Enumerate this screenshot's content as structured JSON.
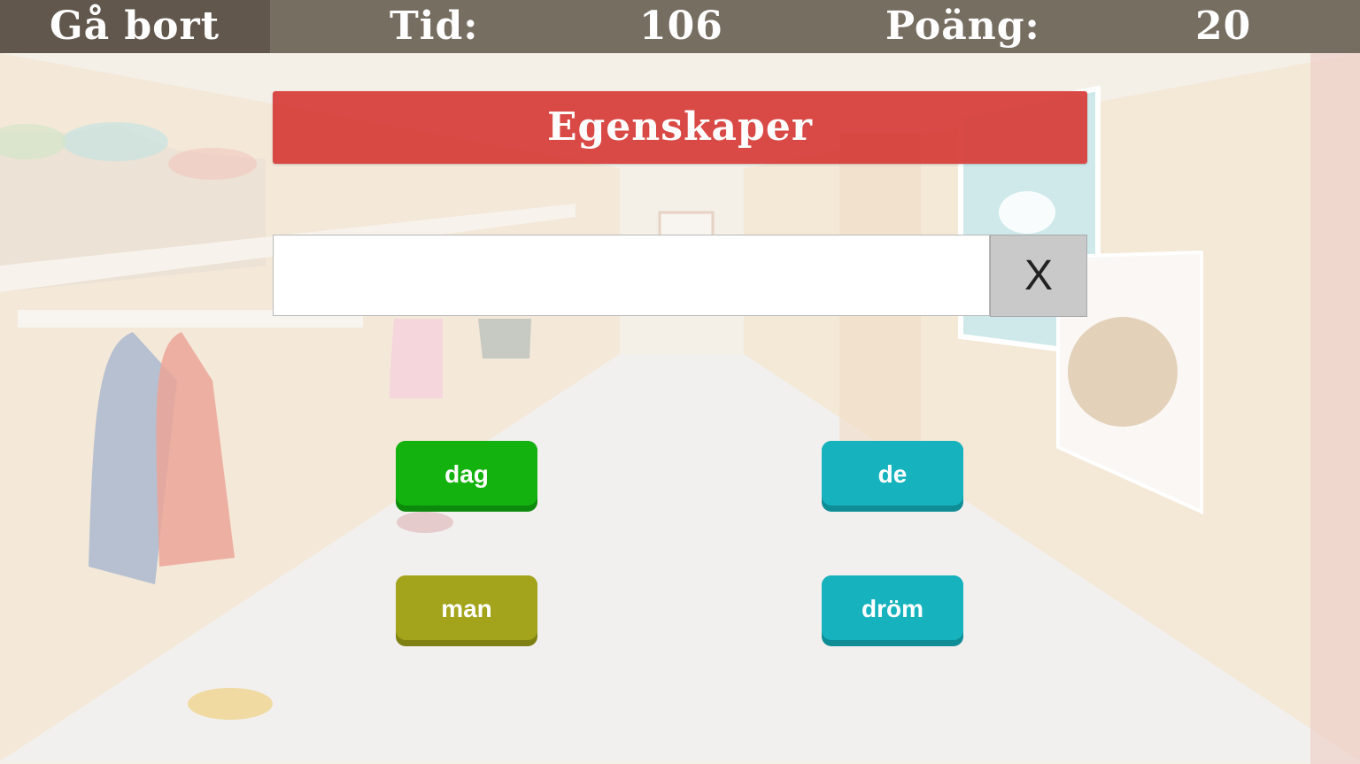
{
  "topbar": {
    "leave_label": "Gå bort",
    "time_label": "Tid:",
    "time_value": "106",
    "score_label": "Poäng:",
    "score_value": "20"
  },
  "category": {
    "title": "Egenskaper"
  },
  "answer": {
    "value": "",
    "clear_label": "X"
  },
  "words": [
    {
      "label": "dag",
      "color": "#13b20f",
      "shadow": "#0c8a0b"
    },
    {
      "label": "de",
      "color": "#16b3be",
      "shadow": "#0f8d96"
    },
    {
      "label": "man",
      "color": "#a3a41b",
      "shadow": "#7f8012"
    },
    {
      "label": "dröm",
      "color": "#16b3be",
      "shadow": "#0f8d96"
    }
  ],
  "colors": {
    "topbar": "#5c5244",
    "banner": "#d63c38",
    "clear_button": "#c9c9c9"
  },
  "icons": {
    "background": "school-hallway-illustration"
  }
}
